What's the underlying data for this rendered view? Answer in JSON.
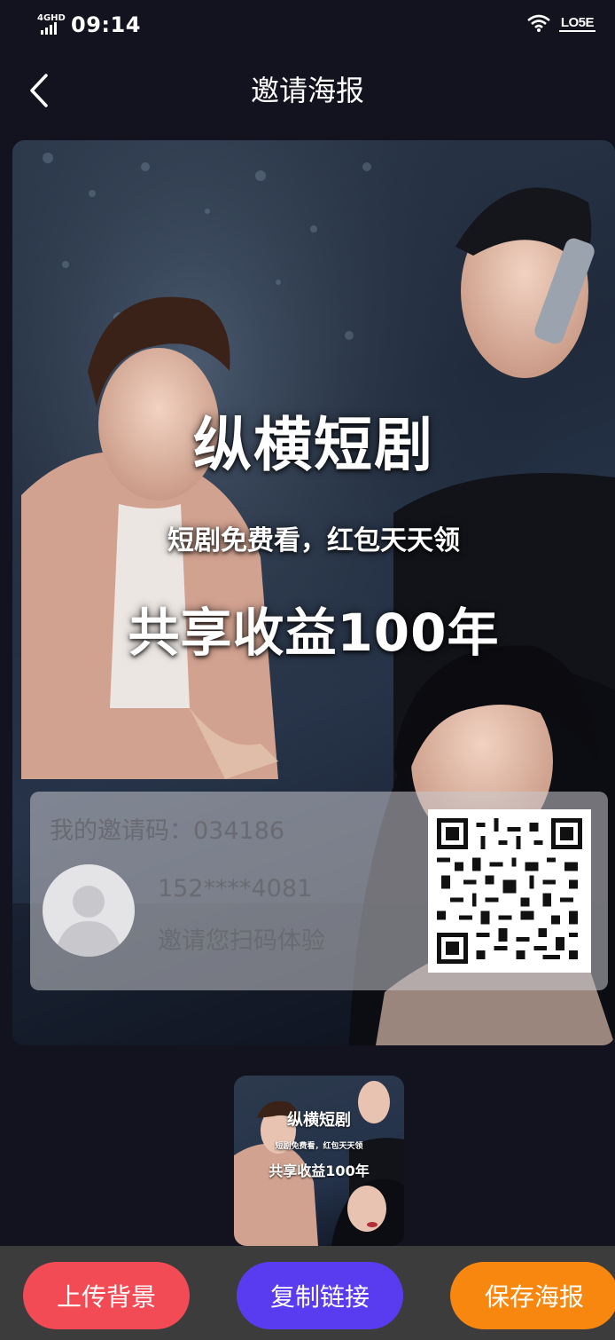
{
  "status": {
    "time": "09:14",
    "network": "4GHD",
    "badge": "LO5E"
  },
  "nav": {
    "title": "邀请海报"
  },
  "poster": {
    "headline": "纵横短剧",
    "subline": "短剧免费看，红包天天领",
    "tagline": "共享收益100年",
    "invite_code": "我的邀请码：034186",
    "phone": "152****4081",
    "hint": "邀请您扫码体验"
  },
  "thumbnail": {
    "headline": "纵横短剧",
    "subline": "短剧免费看，红包天天领",
    "tagline": "共享收益100年"
  },
  "actions": {
    "upload_label": "上传背景",
    "copy_label": "复制链接",
    "save_label": "保存海报"
  },
  "colors": {
    "background": "#13121f",
    "upload": "#f24b55",
    "copy": "#5a3cf0",
    "save": "#f7870e"
  }
}
